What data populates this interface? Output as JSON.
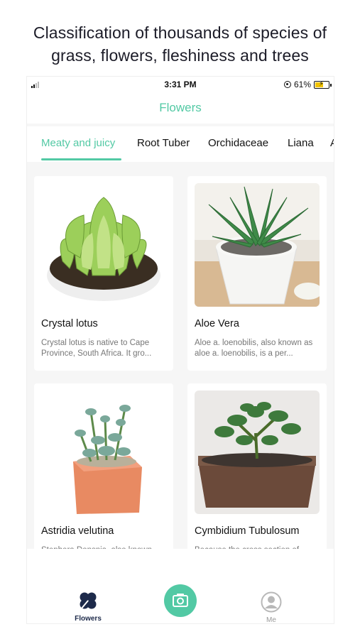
{
  "promo": {
    "line1": "Classification of thousands of species of",
    "line2": "grass, flowers, fleshiness and trees"
  },
  "status_bar": {
    "time": "3:31 PM",
    "battery": "61%"
  },
  "nav": {
    "title": "Flowers"
  },
  "tabs": [
    {
      "label": "Meaty and juicy",
      "active": true
    },
    {
      "label": "Root Tuber",
      "active": false
    },
    {
      "label": "Orchidaceae",
      "active": false
    },
    {
      "label": "Liana",
      "active": false
    },
    {
      "label": "A",
      "active": false
    }
  ],
  "cards": [
    {
      "name": "Crystal lotus",
      "desc": "Crystal lotus is native to Cape Province, South Africa. It gro..."
    },
    {
      "name": "Aloe Vera",
      "desc": "Aloe a. loenobilis, also known as aloe a. loenobilis, is a per..."
    },
    {
      "name": "Astridia velutina",
      "desc": "Stephera Donsnia, also known"
    },
    {
      "name": "Cymbidium Tubulosum",
      "desc": "Because the cross section of"
    }
  ],
  "tabbar": {
    "flowers_label": "Flowers",
    "me_label": "Me"
  },
  "colors": {
    "accent": "#52c9a4",
    "background": "#f6f6f6",
    "text": "#111111"
  },
  "icons": [
    "signal-icon",
    "location-lock-icon",
    "battery-icon",
    "clover-icon",
    "camera-icon",
    "user-icon"
  ]
}
